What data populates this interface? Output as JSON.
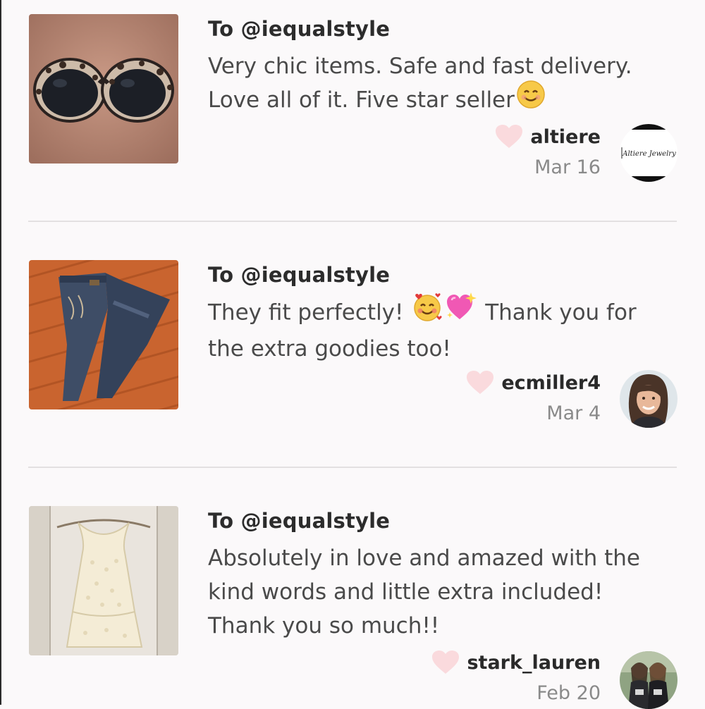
{
  "reviews": [
    {
      "recipient": "To @iequalstyle",
      "lines": [
        "Very chic items. Safe and fast delivery.",
        "Love all of it. Five star seller"
      ],
      "emojis": [
        "smiling-face-emoji"
      ],
      "username": "altiere",
      "date": "Mar 16",
      "avatar_text": "Altiere Jewelry",
      "photo": "sunglasses"
    },
    {
      "recipient": "To @iequalstyle",
      "lines": [
        "They fit perfectly!",
        "Thank you for",
        "the extra goodies too!"
      ],
      "emojis": [
        "smiling-face-with-hearts-emoji",
        "sparkling-heart-emoji"
      ],
      "username": "ecmiller4",
      "date": "Mar 4",
      "photo": "jeans"
    },
    {
      "recipient": "To @iequalstyle",
      "lines": [
        "Absolutely in love and amazed with the",
        "kind words and little extra included!",
        "Thank you so much!!"
      ],
      "username": "stark_lauren",
      "date": "Feb 20",
      "photo": "white-top"
    }
  ],
  "colors": {
    "heart": "#fadadd",
    "divider": "#e3e0e1",
    "date": "#8a8a8a"
  },
  "icons": {
    "like": "heart-icon"
  }
}
